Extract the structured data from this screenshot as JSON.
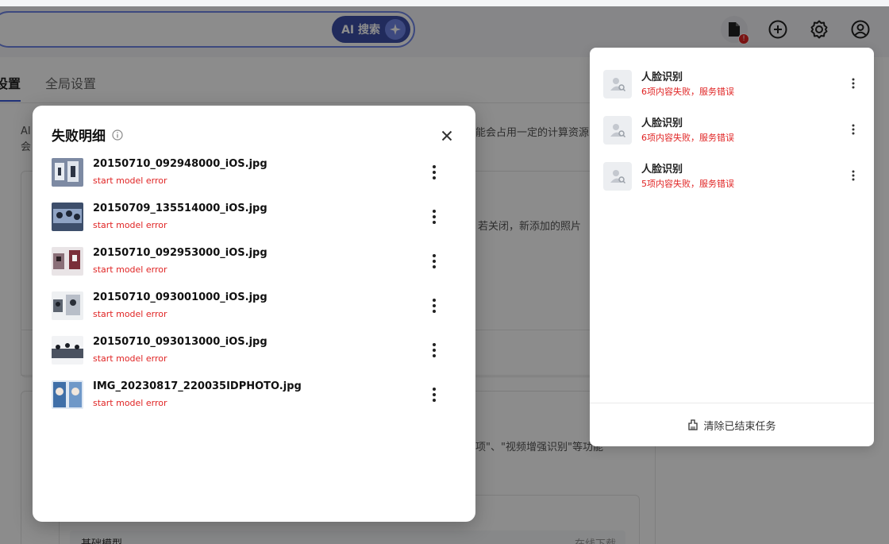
{
  "search": {
    "ai_label": "AI 搜索"
  },
  "header": {
    "task_badge": "!"
  },
  "tabs": [
    {
      "label": "设置"
    },
    {
      "label": "全局设置"
    }
  ],
  "background": {
    "desc_left_line1": "AI",
    "desc_left_line2": "会",
    "desc_right": "能会占用一定的计算资源",
    "card1_text": "若关闭，新添加的照片",
    "card2_text": "项\"、\"视频增强识别\"等功能",
    "card3_left": "基础模型",
    "card3_right": "在线下载"
  },
  "task_panel": {
    "items": [
      {
        "title": "人脸识别",
        "status": "6项内容失败，服务错误"
      },
      {
        "title": "人脸识别",
        "status": "6项内容失败，服务错误"
      },
      {
        "title": "人脸识别",
        "status": "5项内容失败，服务错误"
      }
    ],
    "clear_label": "清除已结束任务"
  },
  "modal": {
    "title": "失败明细",
    "files": [
      {
        "name": "20150710_092948000_iOS.jpg",
        "error": "start model error",
        "thumb_color": "#7d8aa3"
      },
      {
        "name": "20150709_135514000_iOS.jpg",
        "error": "start model error",
        "thumb_color": "#3d4e6b"
      },
      {
        "name": "20150710_092953000_iOS.jpg",
        "error": "start model error",
        "thumb_color": "#8a6f78"
      },
      {
        "name": "20150710_093001000_iOS.jpg",
        "error": "start model error",
        "thumb_color": "#5c6470"
      },
      {
        "name": "20150710_093013000_iOS.jpg",
        "error": "start model error",
        "thumb_color": "#4b5260"
      },
      {
        "name": "IMG_20230817_220035IDPHOTO.jpg",
        "error": "start model error",
        "thumb_color": "#3f6fa8"
      }
    ]
  },
  "colors": {
    "accent": "#3b5bdb",
    "error": "#e02424"
  }
}
